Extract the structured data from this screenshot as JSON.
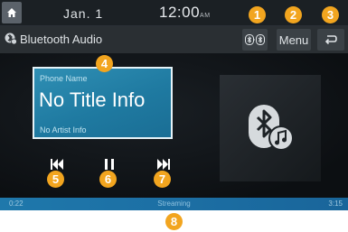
{
  "status_bar": {
    "date": "Jan.  1",
    "time": "12:00",
    "time_suffix": "AM",
    "home_icon": "home-icon"
  },
  "header": {
    "title": "Bluetooth Audio",
    "title_icon": "bluetooth-settings-icon",
    "bt_button_icon": "bluetooth-connection-icon",
    "menu_label": "Menu",
    "back_icon": "back-arrow-icon"
  },
  "track_info": {
    "phone_name": "Phone Name",
    "title": "No Title Info",
    "artist": "No Artist Info"
  },
  "album_art": {
    "icon": "bluetooth-music-icon"
  },
  "controls": {
    "prev_icon": "skip-previous-icon",
    "pause_icon": "pause-icon",
    "next_icon": "skip-next-icon"
  },
  "progress": {
    "elapsed": "0:22",
    "status": "Streaming",
    "total": "3:15"
  },
  "callouts": [
    "1",
    "2",
    "3",
    "4",
    "5",
    "6",
    "7",
    "8"
  ],
  "colors": {
    "accent_blue": "#1f7aa1",
    "callout_orange": "#f2a51f",
    "screen_bg": "#0e1114"
  }
}
